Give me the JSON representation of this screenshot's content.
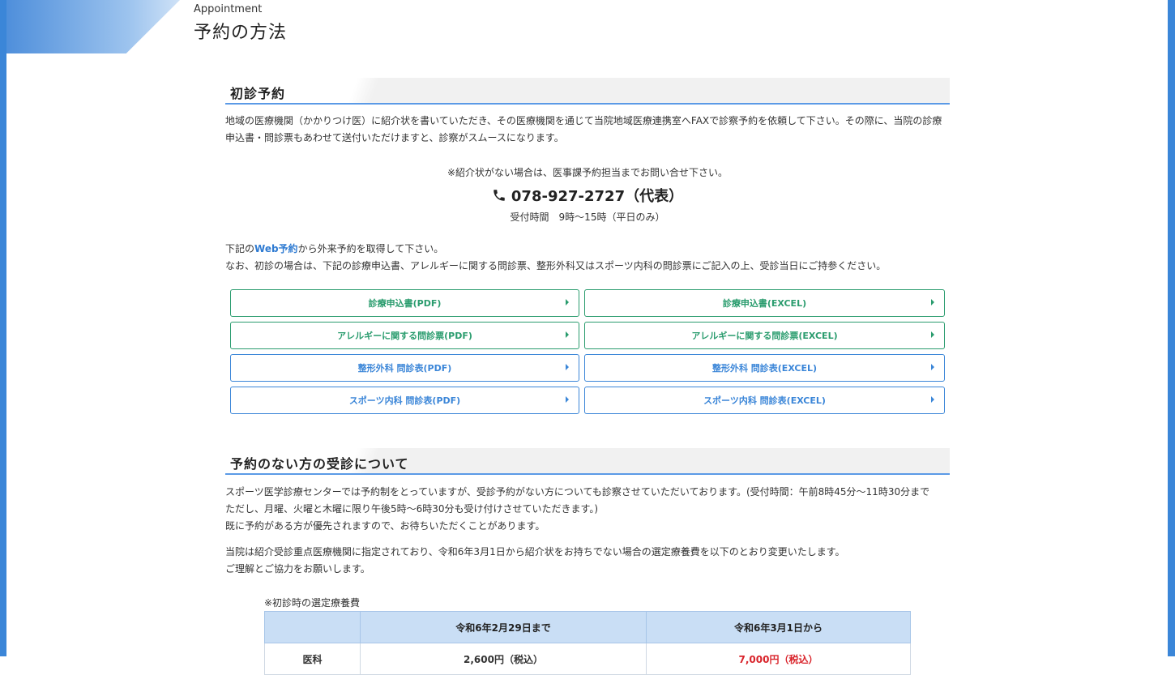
{
  "header": {
    "en": "Appointment",
    "title": "予約の方法"
  },
  "section1": {
    "title": "初診予約",
    "intro": [
      "地域の医療機関（かかりつけ医）に紹介状を書いていただき、その医療機関を通じて当院地域医療連携室へFAXで診察予約を依頼して下さい。その際に、当院の診療",
      "申込書・問診票もあわせて送付いただけますと、診察がスムースになります。"
    ],
    "note": "※紹介状がない場合は、医事課予約担当までお問い合せ下さい。",
    "phone": "078-927-2727（代表）",
    "hours": "受付時間　9時～15時（平日のみ）",
    "web_line_pre": "下記の",
    "web_link": "Web予約",
    "web_line_post": "から外来予約を取得して下さい。",
    "first_visit": "なお、初診の場合は、下記の診療申込書、アレルギーに関する問診票、整形外科又はスポーツ内科の問診票にご記入の上、受診当日にご持参ください。",
    "buttons": [
      {
        "label": "診療申込書(PDF)"
      },
      {
        "label": "診療申込書(EXCEL)"
      },
      {
        "label": "アレルギーに関する問診票(PDF)"
      },
      {
        "label": "アレルギーに関する問診票(EXCEL)"
      },
      {
        "label": "整形外科 問診表(PDF)"
      },
      {
        "label": "整形外科 問診表(EXCEL)"
      },
      {
        "label": "スポーツ内科 問診表(PDF)"
      },
      {
        "label": "スポーツ内科 問診表(EXCEL)"
      }
    ],
    "colors": {
      "green": "#2a9c6e",
      "blue": "#3b86d8"
    }
  },
  "section2": {
    "title": "予約のない方の受診について",
    "p1": [
      "スポーツ医学診療センターでは予約制をとっていますが、受診予約がない方についても診察させていただいております。(受付時間：午前8時45分～11時30分まで",
      "ただし、月曜、火曜と木曜に限り午後5時～6時30分も受け付けさせていただきます。)",
      "既に予約がある方が優先されますので、お待ちいただくことがあります。"
    ],
    "p2": [
      "当院は紹介受診重点医療機関に指定されており、令和6年3月1日から紹介状をお持ちでない場合の選定療養費を以下のとおり変更いたします。",
      "ご理解とご協力をお願いします。"
    ],
    "table_caption": "※初診時の選定療養費",
    "table_headers": [
      "",
      "令和6年2月29日まで",
      "令和6年3月1日から"
    ],
    "table_row": [
      "医科",
      "2,600円（税込）",
      "7,000円（税込）"
    ]
  }
}
